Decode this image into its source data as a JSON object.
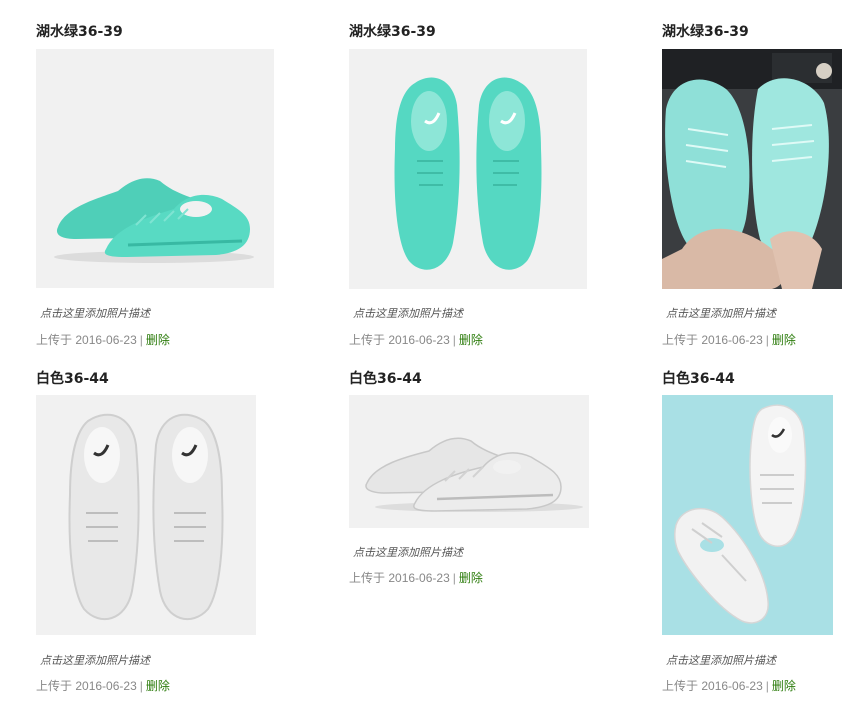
{
  "items": [
    {
      "title": "湖水绿36-39",
      "desc": "点击这里添加照片描述",
      "uploaded_prefix": "上传于",
      "date": "2016-06-23",
      "separator": "|",
      "delete": "删除"
    },
    {
      "title": "湖水绿36-39",
      "desc": "点击这里添加照片描述",
      "uploaded_prefix": "上传于",
      "date": "2016-06-23",
      "separator": "|",
      "delete": "删除"
    },
    {
      "title": "湖水绿36-39",
      "desc": "点击这里添加照片描述",
      "uploaded_prefix": "上传于",
      "date": "2016-06-23",
      "separator": "|",
      "delete": "删除"
    },
    {
      "title": "白色36-44",
      "desc": "点击这里添加照片描述",
      "uploaded_prefix": "上传于",
      "date": "2016-06-23",
      "separator": "|",
      "delete": "删除"
    },
    {
      "title": "白色36-44",
      "desc": "点击这里添加照片描述",
      "uploaded_prefix": "上传于",
      "date": "2016-06-23",
      "separator": "|",
      "delete": "删除"
    },
    {
      "title": "白色36-44",
      "desc": "点击这里添加照片描述",
      "uploaded_prefix": "上传于",
      "date": "2016-06-23",
      "separator": "|",
      "delete": "删除"
    }
  ],
  "colors": {
    "teal": "#55d8c2",
    "teal_light": "#9fe9dc",
    "white_shoe": "#e9e9e9",
    "photo_bg": "#f1f1f1",
    "sky_bg": "#a9e0e5",
    "delete_link": "#2e7d0e"
  }
}
